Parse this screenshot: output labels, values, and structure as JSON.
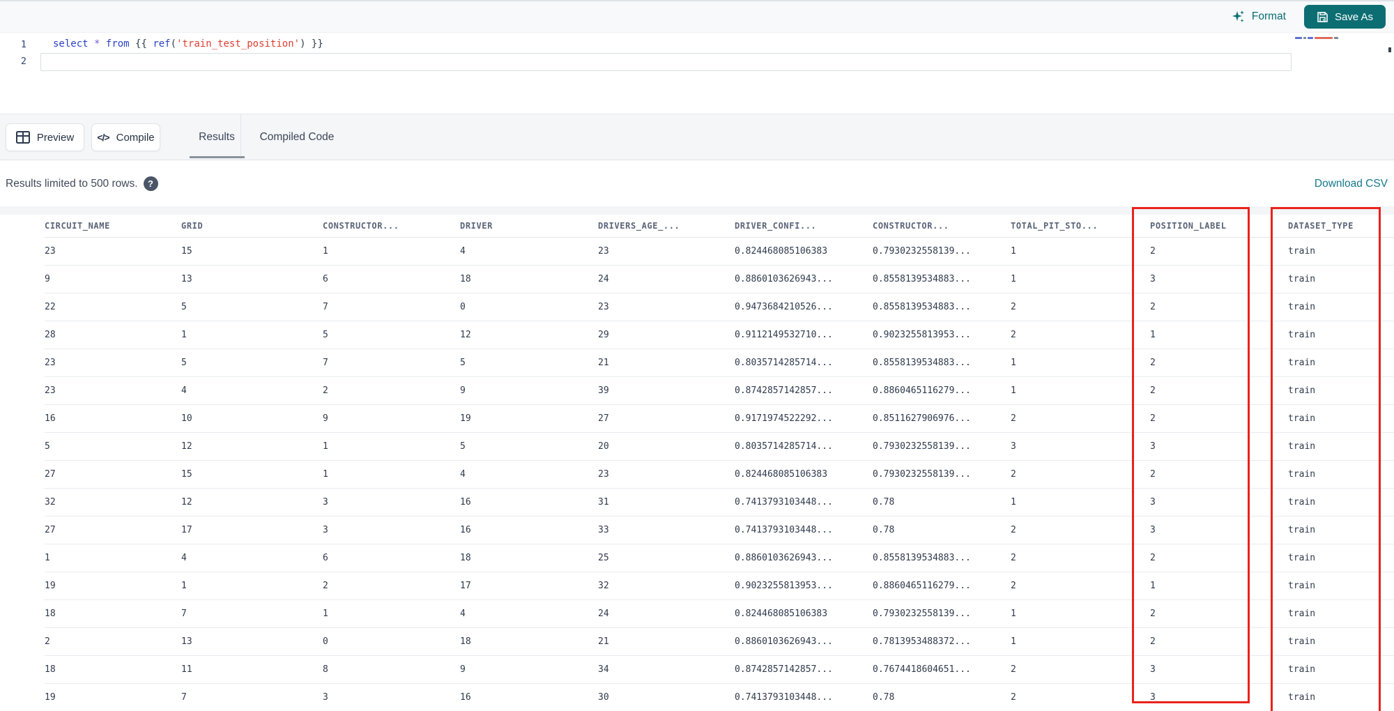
{
  "toolbar": {
    "format_label": "Format",
    "save_as_label": "Save As"
  },
  "editor": {
    "lines": [
      {
        "number": "1",
        "tokens": [
          {
            "text": "select",
            "type": "keyword"
          },
          {
            "text": " ",
            "type": "plain"
          },
          {
            "text": "*",
            "type": "operator"
          },
          {
            "text": " ",
            "type": "plain"
          },
          {
            "text": "from",
            "type": "keyword"
          },
          {
            "text": " {{ ",
            "type": "plain"
          },
          {
            "text": "ref",
            "type": "function"
          },
          {
            "text": "(",
            "type": "plain"
          },
          {
            "text": "'train_test_position'",
            "type": "string"
          },
          {
            "text": ") }}",
            "type": "plain"
          }
        ]
      },
      {
        "number": "2",
        "tokens": []
      }
    ]
  },
  "actions": {
    "preview_label": "Preview",
    "compile_label": "Compile"
  },
  "tabs": {
    "results_label": "Results",
    "compiled_label": "Compiled Code",
    "active": "Results"
  },
  "results": {
    "limit_note": "Results limited to 500 rows.",
    "download_csv_label": "Download CSV"
  },
  "table": {
    "columns": [
      "CIRCUIT_NAME",
      "GRID",
      "CONSTRUCTOR...",
      "DRIVER",
      "DRIVERS_AGE_...",
      "DRIVER_CONFI...",
      "CONSTRUCTOR...",
      "TOTAL_PIT_STO...",
      "POSITION_LABEL",
      "DATASET_TYPE"
    ],
    "highlighted_columns": [
      "POSITION_LABEL",
      "DATASET_TYPE"
    ],
    "rows": [
      [
        "23",
        "15",
        "1",
        "4",
        "23",
        "0.824468085106383",
        "0.7930232558139...",
        "1",
        "2",
        "train"
      ],
      [
        "9",
        "13",
        "6",
        "18",
        "24",
        "0.8860103626943...",
        "0.8558139534883...",
        "1",
        "3",
        "train"
      ],
      [
        "22",
        "5",
        "7",
        "0",
        "23",
        "0.9473684210526...",
        "0.8558139534883...",
        "2",
        "2",
        "train"
      ],
      [
        "28",
        "1",
        "5",
        "12",
        "29",
        "0.9112149532710...",
        "0.9023255813953...",
        "2",
        "1",
        "train"
      ],
      [
        "23",
        "5",
        "7",
        "5",
        "21",
        "0.8035714285714...",
        "0.8558139534883...",
        "1",
        "2",
        "train"
      ],
      [
        "23",
        "4",
        "2",
        "9",
        "39",
        "0.8742857142857...",
        "0.8860465116279...",
        "1",
        "2",
        "train"
      ],
      [
        "16",
        "10",
        "9",
        "19",
        "27",
        "0.9171974522292...",
        "0.8511627906976...",
        "2",
        "2",
        "train"
      ],
      [
        "5",
        "12",
        "1",
        "5",
        "20",
        "0.8035714285714...",
        "0.7930232558139...",
        "3",
        "3",
        "train"
      ],
      [
        "27",
        "15",
        "1",
        "4",
        "23",
        "0.824468085106383",
        "0.7930232558139...",
        "2",
        "2",
        "train"
      ],
      [
        "32",
        "12",
        "3",
        "16",
        "31",
        "0.7413793103448...",
        "0.78",
        "1",
        "3",
        "train"
      ],
      [
        "27",
        "17",
        "3",
        "16",
        "33",
        "0.7413793103448...",
        "0.78",
        "2",
        "3",
        "train"
      ],
      [
        "1",
        "4",
        "6",
        "18",
        "25",
        "0.8860103626943...",
        "0.8558139534883...",
        "2",
        "2",
        "train"
      ],
      [
        "19",
        "1",
        "2",
        "17",
        "32",
        "0.9023255813953...",
        "0.8860465116279...",
        "2",
        "1",
        "train"
      ],
      [
        "18",
        "7",
        "1",
        "4",
        "24",
        "0.824468085106383",
        "0.7930232558139...",
        "1",
        "2",
        "train"
      ],
      [
        "2",
        "13",
        "0",
        "18",
        "21",
        "0.8860103626943...",
        "0.7813953488372...",
        "1",
        "2",
        "train"
      ],
      [
        "18",
        "11",
        "8",
        "9",
        "34",
        "0.8742857142857...",
        "0.7674418604651...",
        "2",
        "3",
        "train"
      ],
      [
        "19",
        "7",
        "3",
        "16",
        "30",
        "0.7413793103448...",
        "0.78",
        "2",
        "3",
        "train"
      ]
    ]
  },
  "colors": {
    "accent_teal": "#0c6e73",
    "link_teal": "#15788c",
    "highlight_red": "#ea221c",
    "keyword_blue": "#2743c6",
    "string_red": "#de3d32"
  }
}
